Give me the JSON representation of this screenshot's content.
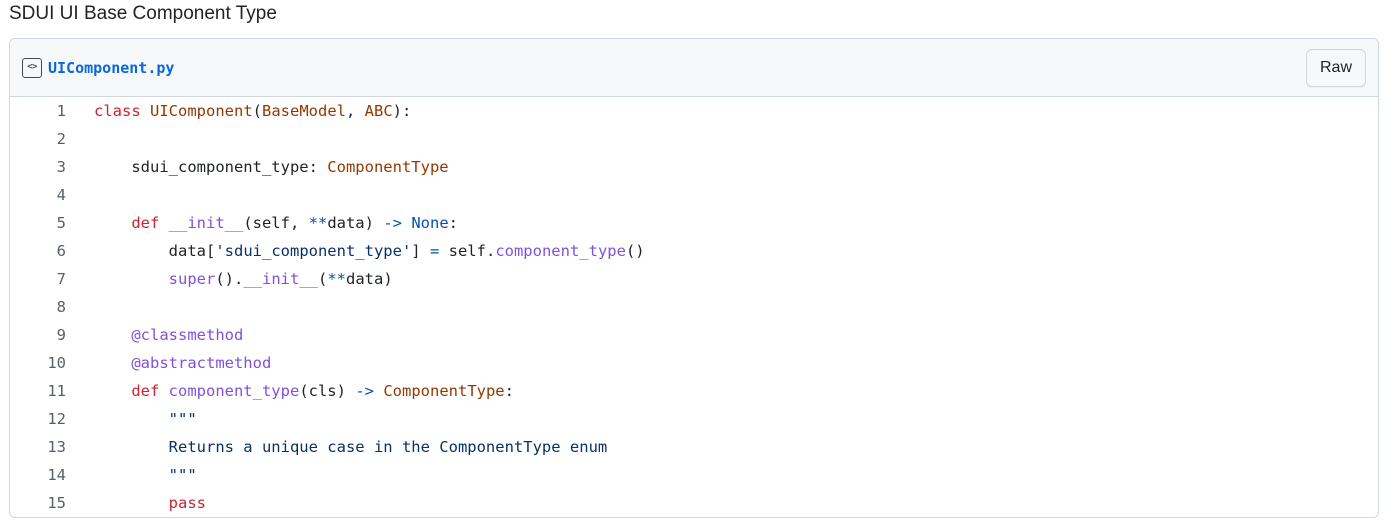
{
  "page": {
    "title": "SDUI UI Base Component Type"
  },
  "gist": {
    "file_icon": "code-file-icon",
    "file_name": "UIComponent.py",
    "raw_label": "Raw"
  },
  "code": {
    "lines": [
      [
        {
          "t": "class ",
          "c": "kw"
        },
        {
          "t": "UIComponent",
          "c": "ty"
        },
        {
          "t": "(",
          "c": ""
        },
        {
          "t": "BaseModel",
          "c": "ty"
        },
        {
          "t": ", ",
          "c": ""
        },
        {
          "t": "ABC",
          "c": "ty"
        },
        {
          "t": "):",
          "c": ""
        }
      ],
      [],
      [
        {
          "t": "    sdui_component_type: ",
          "c": ""
        },
        {
          "t": "ComponentType",
          "c": "ty"
        }
      ],
      [],
      [
        {
          "t": "    ",
          "c": ""
        },
        {
          "t": "def ",
          "c": "kw"
        },
        {
          "t": "__init__",
          "c": "fn"
        },
        {
          "t": "(self, ",
          "c": ""
        },
        {
          "t": "**",
          "c": "op"
        },
        {
          "t": "data) ",
          "c": ""
        },
        {
          "t": "->",
          "c": "op"
        },
        {
          "t": " ",
          "c": ""
        },
        {
          "t": "None",
          "c": "op"
        },
        {
          "t": ":",
          "c": ""
        }
      ],
      [
        {
          "t": "        data[",
          "c": ""
        },
        {
          "t": "'sdui_component_type'",
          "c": "st"
        },
        {
          "t": "] ",
          "c": ""
        },
        {
          "t": "=",
          "c": "op"
        },
        {
          "t": " self.",
          "c": ""
        },
        {
          "t": "component_type",
          "c": "fn"
        },
        {
          "t": "()",
          "c": ""
        }
      ],
      [
        {
          "t": "        ",
          "c": ""
        },
        {
          "t": "super",
          "c": "fn"
        },
        {
          "t": "().",
          "c": ""
        },
        {
          "t": "__init__",
          "c": "fn"
        },
        {
          "t": "(",
          "c": ""
        },
        {
          "t": "**",
          "c": "op"
        },
        {
          "t": "data)",
          "c": ""
        }
      ],
      [],
      [
        {
          "t": "    ",
          "c": ""
        },
        {
          "t": "@classmethod",
          "c": "fn"
        }
      ],
      [
        {
          "t": "    ",
          "c": ""
        },
        {
          "t": "@abstractmethod",
          "c": "fn"
        }
      ],
      [
        {
          "t": "    ",
          "c": ""
        },
        {
          "t": "def ",
          "c": "kw"
        },
        {
          "t": "component_type",
          "c": "fn"
        },
        {
          "t": "(cls) ",
          "c": ""
        },
        {
          "t": "->",
          "c": "op"
        },
        {
          "t": " ",
          "c": ""
        },
        {
          "t": "ComponentType",
          "c": "ty"
        },
        {
          "t": ":",
          "c": ""
        }
      ],
      [
        {
          "t": "        ",
          "c": ""
        },
        {
          "t": "\"\"\"",
          "c": "st"
        }
      ],
      [
        {
          "t": "        ",
          "c": ""
        },
        {
          "t": "Returns a unique case in the ComponentType enum",
          "c": "st"
        }
      ],
      [
        {
          "t": "        ",
          "c": ""
        },
        {
          "t": "\"\"\"",
          "c": "st"
        }
      ],
      [
        {
          "t": "        ",
          "c": ""
        },
        {
          "t": "pass",
          "c": "kw"
        }
      ]
    ]
  },
  "colors": {
    "keyword": "#cf222e",
    "type": "#953800",
    "function": "#8250df",
    "operator": "#0550ae",
    "string": "#0a3069",
    "link": "#0969da"
  }
}
